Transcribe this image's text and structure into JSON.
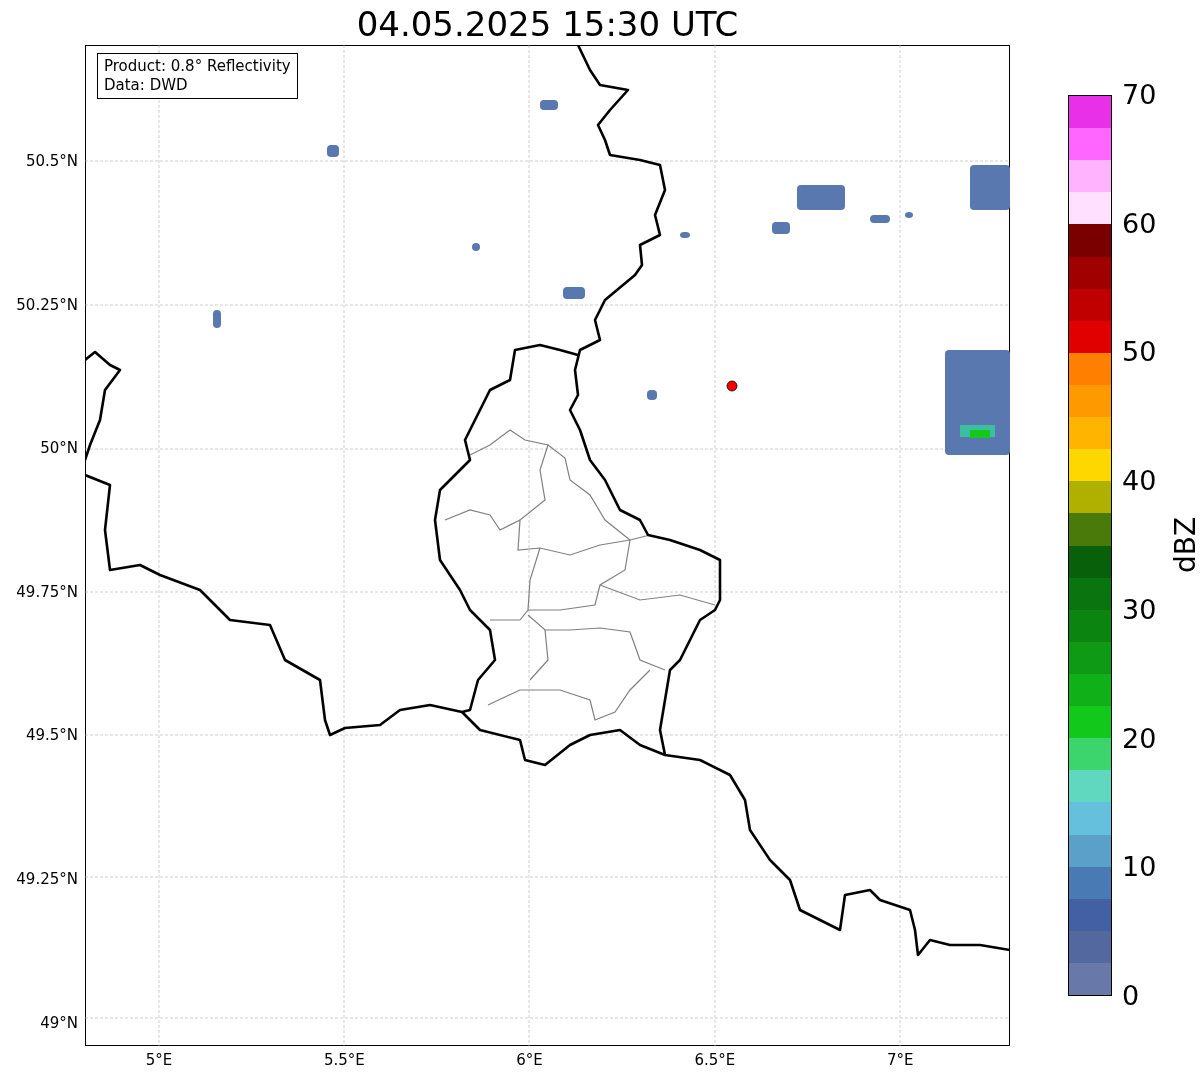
{
  "title": "04.05.2025 15:30 UTC",
  "legend_box": {
    "lines": [
      "Product: 0.8° Reflectivity",
      "Data: DWD"
    ]
  },
  "map": {
    "lat_labels": [
      "50.5°N",
      "50.25°N",
      "50°N",
      "49.75°N",
      "49.5°N",
      "49.25°N",
      "49°N"
    ],
    "lon_labels": [
      "5°E",
      "5.5°E",
      "6°E",
      "6.5°E",
      "7°E"
    ]
  },
  "colorbar": {
    "label": "dBZ",
    "ticks": [
      "70",
      "60",
      "50",
      "40",
      "30",
      "20",
      "10",
      "0"
    ],
    "segments": [
      {
        "color": "#e930e9"
      },
      {
        "color": "#ff66ff"
      },
      {
        "color": "#ffb3ff"
      },
      {
        "color": "#ffe0ff"
      },
      {
        "color": "#7a0000"
      },
      {
        "color": "#a00000"
      },
      {
        "color": "#c00000"
      },
      {
        "color": "#e00000"
      },
      {
        "color": "#ff7f00"
      },
      {
        "color": "#ff9900"
      },
      {
        "color": "#ffb400"
      },
      {
        "color": "#ffd700"
      },
      {
        "color": "#b0b000"
      },
      {
        "color": "#4a7a0a"
      },
      {
        "color": "#08600a"
      },
      {
        "color": "#0a740e"
      },
      {
        "color": "#0c8510"
      },
      {
        "color": "#0e9a14"
      },
      {
        "color": "#10b018"
      },
      {
        "color": "#12c81a"
      },
      {
        "color": "#3cd46c"
      },
      {
        "color": "#60d8c0"
      },
      {
        "color": "#64c0dc"
      },
      {
        "color": "#5aa0c8"
      },
      {
        "color": "#4a7ab4"
      },
      {
        "color": "#4460a4"
      },
      {
        "color": "#5468a0"
      },
      {
        "color": "#6878a8"
      }
    ]
  }
}
